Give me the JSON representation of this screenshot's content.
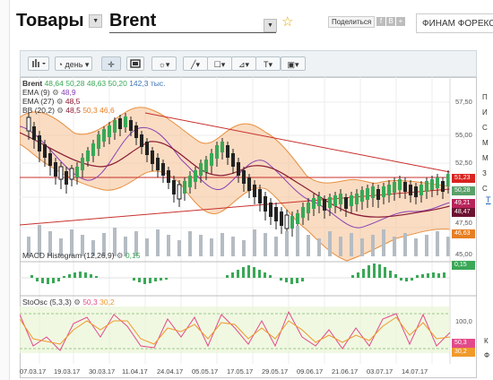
{
  "header": {
    "category": "Товары",
    "instrument": "Brent",
    "share_label": "Поделиться",
    "share_icons": [
      "f",
      "В",
      "+"
    ],
    "broker_text": "ФИНАМ ФОРЕКС"
  },
  "toolbar": {
    "chart_type_icon": "bar-chart-icon",
    "period_label": "день",
    "buttons": [
      "crosshair-icon",
      "fullscreen-icon",
      "indicators-icon",
      "draw-line-icon",
      "shapes-icon",
      "fib-tools-icon",
      "text-tool-icon",
      "image-export-icon"
    ],
    "text_tool_label": "T"
  },
  "legend": {
    "symbol": "Brent",
    "ohlc": [
      "48,64",
      "50,28",
      "48,63",
      "50,20"
    ],
    "volume": "142,3 тыс.",
    "ema9_label": "EMA (9)",
    "ema9_value": "48,9",
    "ema27_label": "EMA (27)",
    "ema27_value": "48,5",
    "bb_label": "BB (20,2)",
    "bb_values": [
      "48,5",
      "50,3",
      "46,6"
    ],
    "macd_label": "MACD Histogram (12,26,9)",
    "macd_value": "0,15",
    "sto_label": "StoOsc (5,3,3)",
    "sto_values": [
      "50,3",
      "30,2"
    ]
  },
  "price_axis": {
    "ticks": [
      "57,50",
      "55,00",
      "52,50",
      "47,50",
      "45,00"
    ],
    "tags": [
      {
        "value": "51,23",
        "color": "#d9231f"
      },
      {
        "value": "50,28",
        "color": "#5aa06a"
      },
      {
        "value": "49,21",
        "color": "#b8245a"
      },
      {
        "value": "48,47",
        "color": "#6d1230"
      },
      {
        "value": "46,63",
        "color": "#e77e22"
      }
    ]
  },
  "macd_axis": {
    "tag": "0,15",
    "color": "#3aa857"
  },
  "sto_axis": {
    "top": "100,0",
    "tags": [
      {
        "value": "50,3",
        "color": "#e24a8a"
      },
      {
        "value": "30,2",
        "color": "#ef9a2a"
      }
    ]
  },
  "x_axis": [
    "07.03.17",
    "19.03.17",
    "30.03.17",
    "11.04.17",
    "24.04.17",
    "05.05.17",
    "17.05.17",
    "29.05.17",
    "09.06.17",
    "21.06.17",
    "03.07.17",
    "14.07.17"
  ],
  "right_panel_letters": [
    "П",
    "И",
    "С",
    "М",
    "М",
    "З",
    "С"
  ],
  "right_panel_link": "Т",
  "right_panel_bottom": [
    "К",
    "Ф"
  ]
}
